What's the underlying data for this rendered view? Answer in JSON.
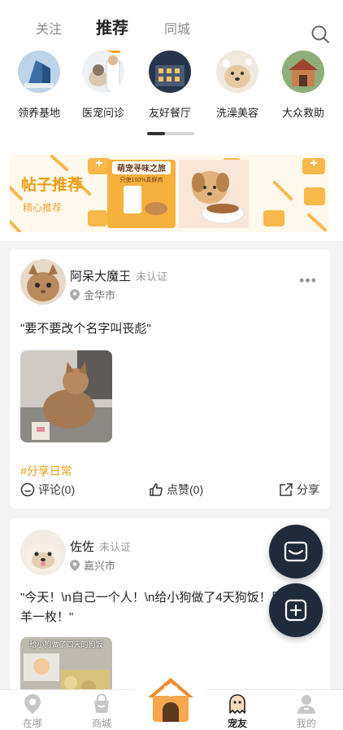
{
  "tabs": [
    "关注",
    "推荐",
    "同城"
  ],
  "categories": [
    {
      "label": "领养基地"
    },
    {
      "label": "医宠问诊"
    },
    {
      "label": "友好餐厅"
    },
    {
      "label": "洗澡美容"
    },
    {
      "label": "大众救助"
    }
  ],
  "banner": {
    "title": "帖子推荐",
    "subtitle": "精心推荐",
    "poster_title": "萌宠寻味之旅",
    "poster_sub": "只使100%真鲜肉"
  },
  "posts": [
    {
      "user": "阿呆大魔王",
      "status": "未认证",
      "location": "金华市",
      "content": "\"要不要改个名字叫丧彪\"",
      "tag": "#分享日常",
      "comment": "评论(0)",
      "like": "点赞(0)",
      "share": "分享"
    },
    {
      "user": "佐佐",
      "status": "未认证",
      "location": "嘉兴市",
      "content": "\"今天！\\n自己一个人！\\n给小狗做了4天狗饭！厉害的小羊一枚！\"",
      "pic_caption": "给小狗做了四天的狗饭"
    }
  ],
  "nav": [
    "在哪",
    "商城",
    "宠友",
    "我的"
  ],
  "colors": {
    "accent": "#f39c12",
    "fab": "#1f2a3a"
  }
}
